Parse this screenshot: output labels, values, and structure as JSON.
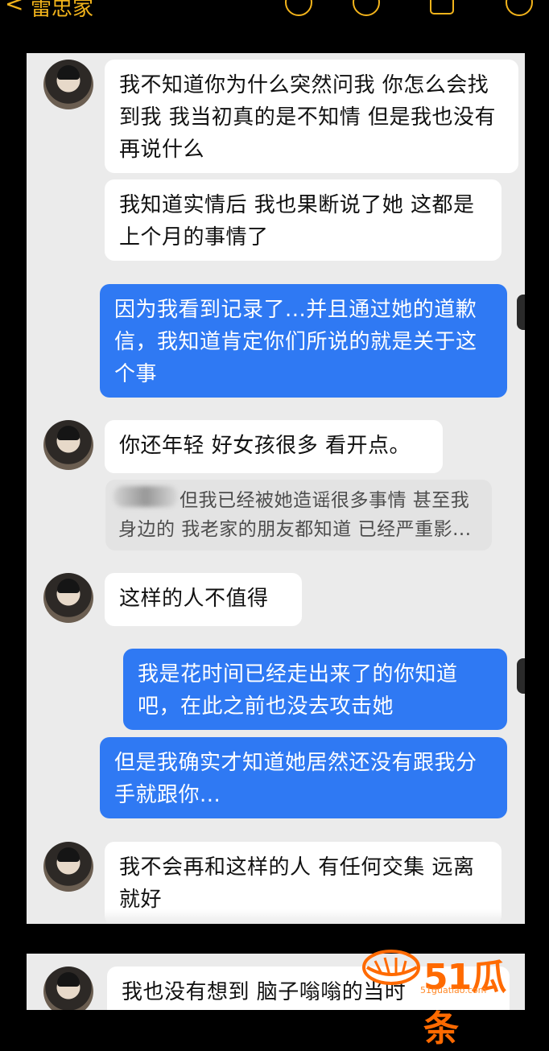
{
  "header": {
    "back_glyph": "<",
    "contact_name": "雷忠家"
  },
  "messages": [
    {
      "side": "in",
      "text": "我不知道你为什么突然问我 你怎么会找到我 我当初真的是不知情 但是我也没有再说什么"
    },
    {
      "side": "in",
      "text": "我知道实情后 我也果断说了她 这都是上个月的事情了"
    },
    {
      "side": "out",
      "text": "因为我看到记录了...并且通过她的道歉信，我知道肯定你们所说的就是关于这个事"
    },
    {
      "side": "in",
      "text": "你还年轻 好女孩很多 看开点。"
    },
    {
      "side": "quote",
      "text": "但我已经被她造谣很多事情 甚至我身边的 我老家的朋友都知道 已经严重影..."
    },
    {
      "side": "in",
      "text": "这样的人不值得"
    },
    {
      "side": "out",
      "text": "我是花时间已经走出来了的你知道吧，在此之前也没去攻击她"
    },
    {
      "side": "out",
      "text": "但是我确实才知道她居然还没有跟我分手就跟你..."
    },
    {
      "side": "in",
      "text": "我不会再和这样的人 有任何交集 远离就好"
    },
    {
      "side": "in",
      "text": "我也没有想到 脑子嗡嗡的当时"
    }
  ],
  "watermark": {
    "brand": "51瓜条",
    "url": "51guatiao.com"
  },
  "colors": {
    "accent": "#f2b31b",
    "outgoing_bubble": "#2f79f3",
    "incoming_bubble": "#ffffff",
    "chat_background": "#ebebeb"
  }
}
